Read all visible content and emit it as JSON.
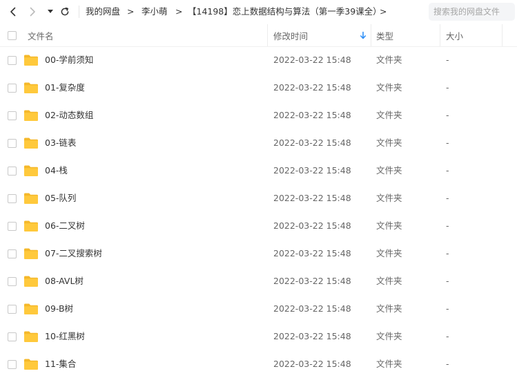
{
  "breadcrumb": {
    "items": [
      "我的网盘",
      "李小萌",
      "【14198】恋上数据结构与算法（第一季39课全）"
    ],
    "separator": ">"
  },
  "search": {
    "placeholder": "搜索我的网盘文件"
  },
  "columns": {
    "name": "文件名",
    "modified": "修改时间",
    "type": "类型",
    "size": "大小"
  },
  "sort": {
    "column": "modified",
    "direction": "descending"
  },
  "colors": {
    "accent": "#2f8ff7",
    "folder": "#ffc93c",
    "folder_back": "#f5b82a"
  },
  "files": [
    {
      "name": "00-学前须知",
      "modified": "2022-03-22 15:48",
      "type": "文件夹",
      "size": "-"
    },
    {
      "name": "01-复杂度",
      "modified": "2022-03-22 15:48",
      "type": "文件夹",
      "size": "-"
    },
    {
      "name": "02-动态数组",
      "modified": "2022-03-22 15:48",
      "type": "文件夹",
      "size": "-"
    },
    {
      "name": "03-链表",
      "modified": "2022-03-22 15:48",
      "type": "文件夹",
      "size": "-"
    },
    {
      "name": "04-栈",
      "modified": "2022-03-22 15:48",
      "type": "文件夹",
      "size": "-"
    },
    {
      "name": "05-队列",
      "modified": "2022-03-22 15:48",
      "type": "文件夹",
      "size": "-"
    },
    {
      "name": "06-二叉树",
      "modified": "2022-03-22 15:48",
      "type": "文件夹",
      "size": "-"
    },
    {
      "name": "07-二叉搜索树",
      "modified": "2022-03-22 15:48",
      "type": "文件夹",
      "size": "-"
    },
    {
      "name": "08-AVL树",
      "modified": "2022-03-22 15:48",
      "type": "文件夹",
      "size": "-"
    },
    {
      "name": "09-B树",
      "modified": "2022-03-22 15:48",
      "type": "文件夹",
      "size": "-"
    },
    {
      "name": "10-红黑树",
      "modified": "2022-03-22 15:48",
      "type": "文件夹",
      "size": "-"
    },
    {
      "name": "11-集合",
      "modified": "2022-03-22 15:48",
      "type": "文件夹",
      "size": "-"
    }
  ]
}
